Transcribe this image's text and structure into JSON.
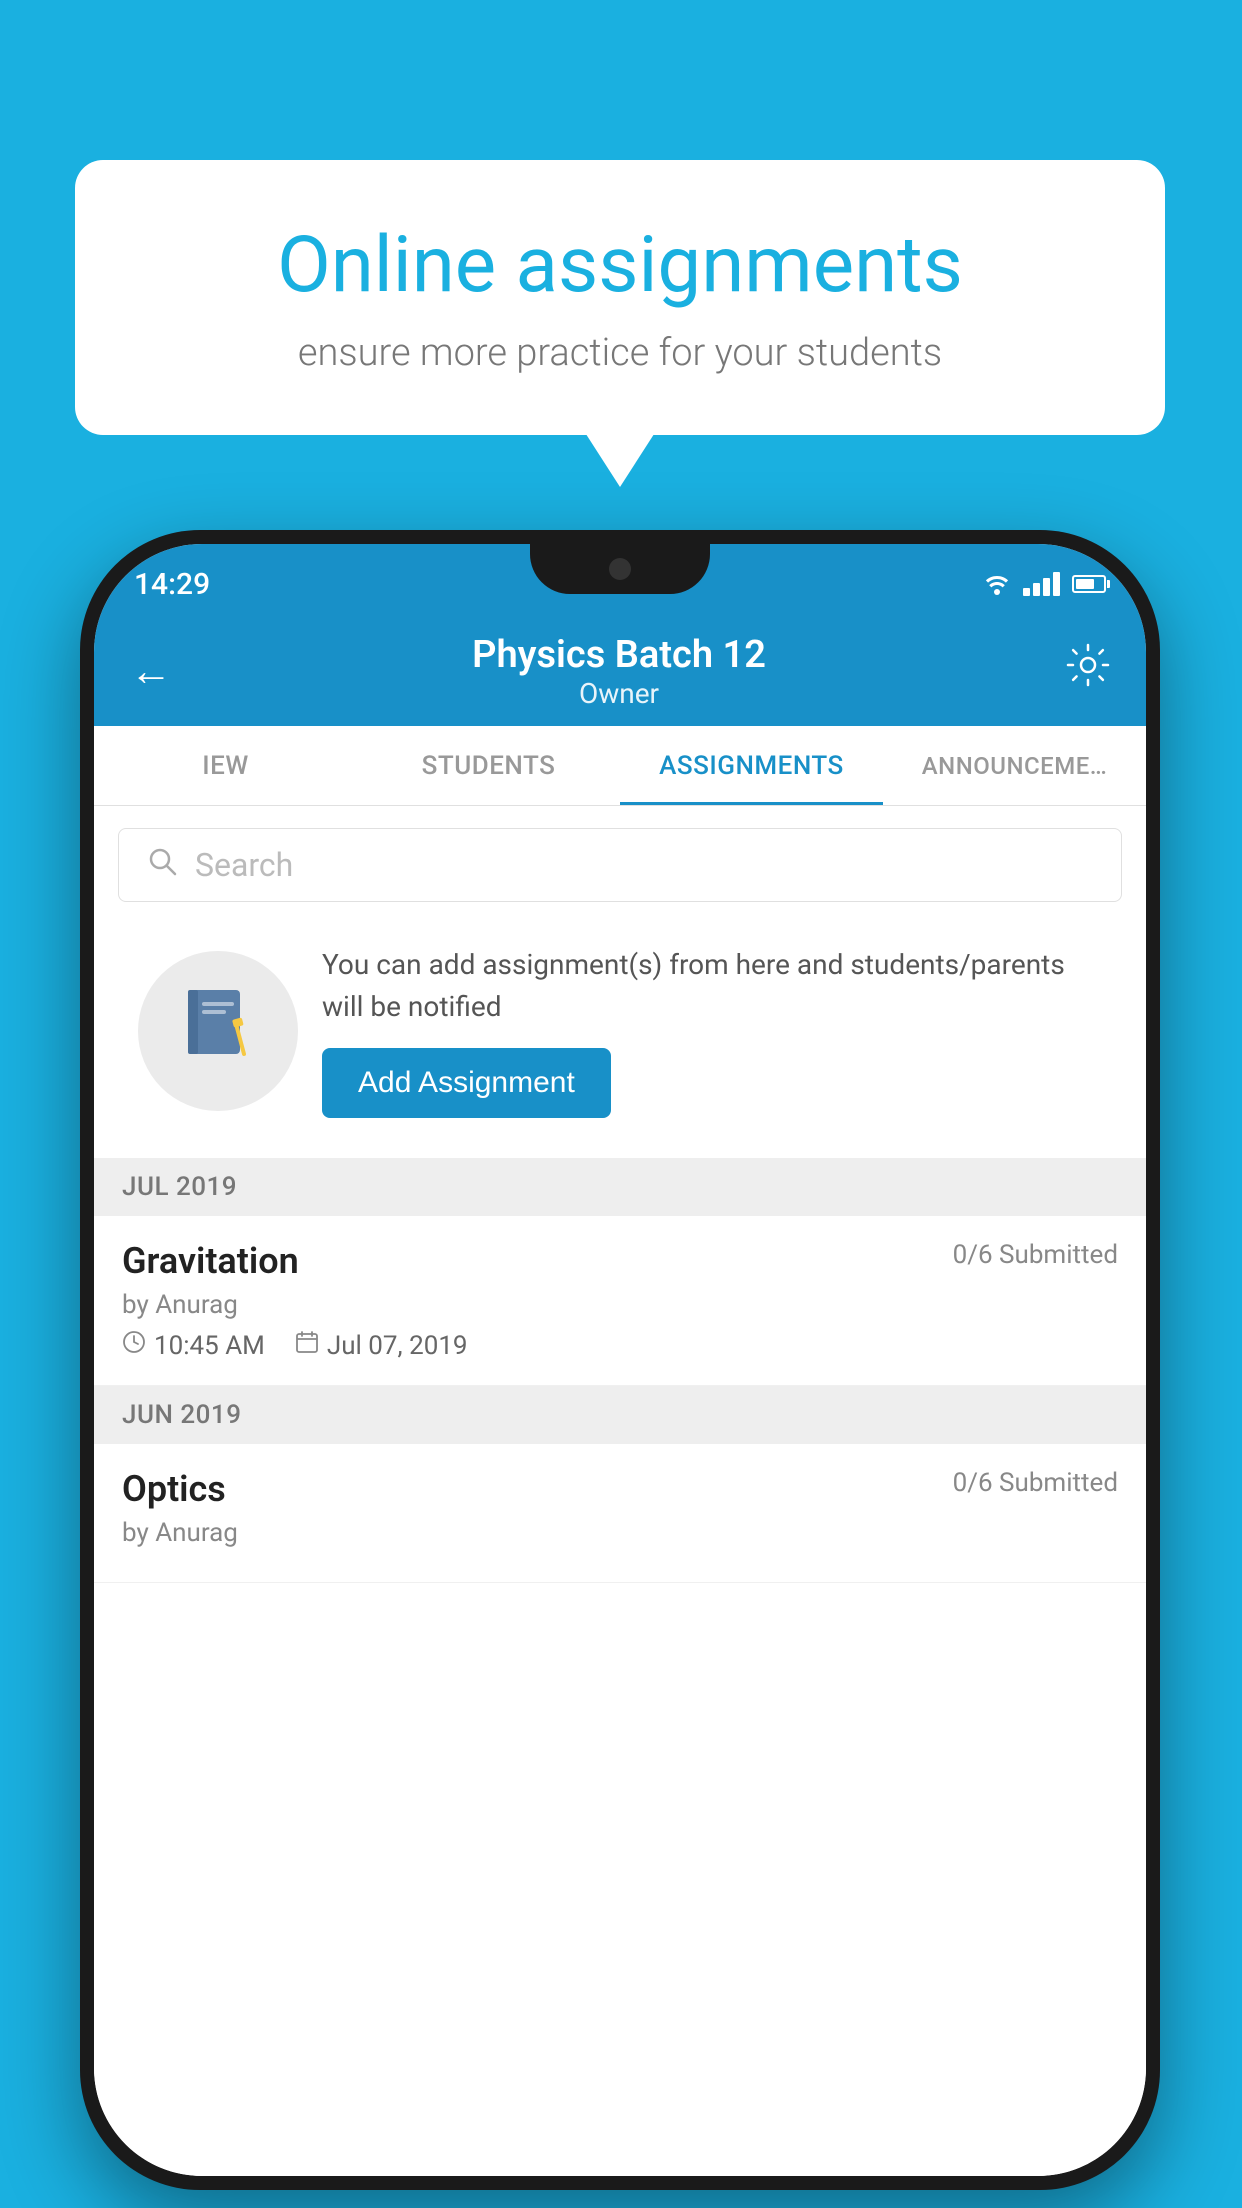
{
  "background_color": "#1ab0e0",
  "speech_bubble": {
    "title": "Online assignments",
    "subtitle": "ensure more practice for your students"
  },
  "phone": {
    "status_bar": {
      "time": "14:29"
    },
    "header": {
      "title": "Physics Batch 12",
      "subtitle": "Owner",
      "back_label": "←",
      "settings_label": "⚙"
    },
    "tabs": [
      {
        "label": "IEW",
        "active": false
      },
      {
        "label": "STUDENTS",
        "active": false
      },
      {
        "label": "ASSIGNMENTS",
        "active": true
      },
      {
        "label": "ANNOUNCEMENTS",
        "active": false
      }
    ],
    "search": {
      "placeholder": "Search"
    },
    "promo": {
      "description": "You can add assignment(s) from here and students/parents will be notified",
      "button_label": "Add Assignment"
    },
    "sections": [
      {
        "label": "JUL 2019",
        "assignments": [
          {
            "name": "Gravitation",
            "submitted": "0/6 Submitted",
            "author": "by Anurag",
            "time": "10:45 AM",
            "date": "Jul 07, 2019"
          }
        ]
      },
      {
        "label": "JUN 2019",
        "assignments": [
          {
            "name": "Optics",
            "submitted": "0/6 Submitted",
            "author": "by Anurag",
            "time": "",
            "date": ""
          }
        ]
      }
    ]
  }
}
